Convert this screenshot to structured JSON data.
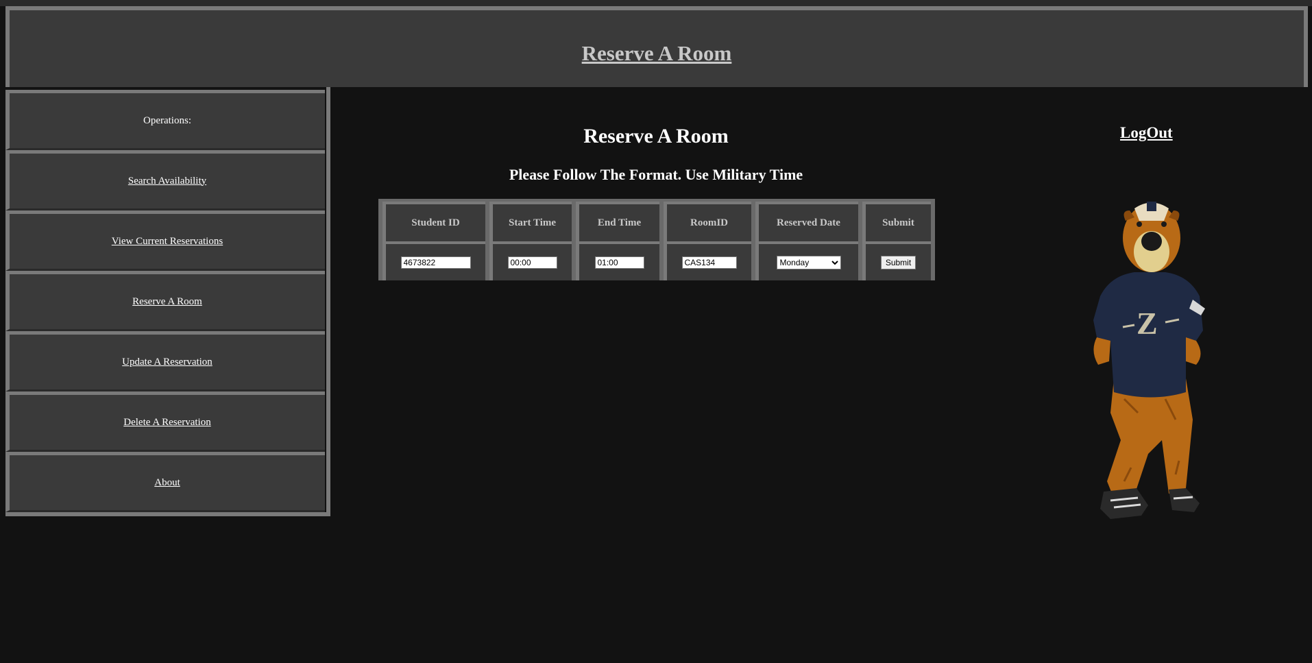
{
  "header": {
    "title": "Reserve A Room"
  },
  "sidebar": {
    "items": [
      {
        "label": "Operations:",
        "link": false
      },
      {
        "label": "Search Availability",
        "link": true
      },
      {
        "label": "View Current Reservations",
        "link": true
      },
      {
        "label": "Reserve A Room",
        "link": true
      },
      {
        "label": "Update A Reservation",
        "link": true
      },
      {
        "label": "Delete A Reservation",
        "link": true
      },
      {
        "label": "About",
        "link": true
      }
    ]
  },
  "main": {
    "title": "Reserve A Room",
    "subtitle": "Please Follow The Format. Use Military Time",
    "logout_label": "LogOut"
  },
  "table": {
    "headers": [
      "Student ID",
      "Start Time",
      "End Time",
      "RoomID",
      "Reserved Date",
      "Submit"
    ],
    "student_id": "4673822",
    "start_time": "00:00",
    "end_time": "01:00",
    "room_id": "CAS134",
    "reserved_date": "Monday",
    "submit_label": "Submit"
  },
  "mascot": {
    "icon": "mascot-image",
    "shirt_letter": "Z"
  },
  "colors": {
    "background": "#121212",
    "panel": "#3a3a3a",
    "border": "#7a7a7a",
    "text": "#ffffff",
    "header_text": "#c8c8c8"
  }
}
